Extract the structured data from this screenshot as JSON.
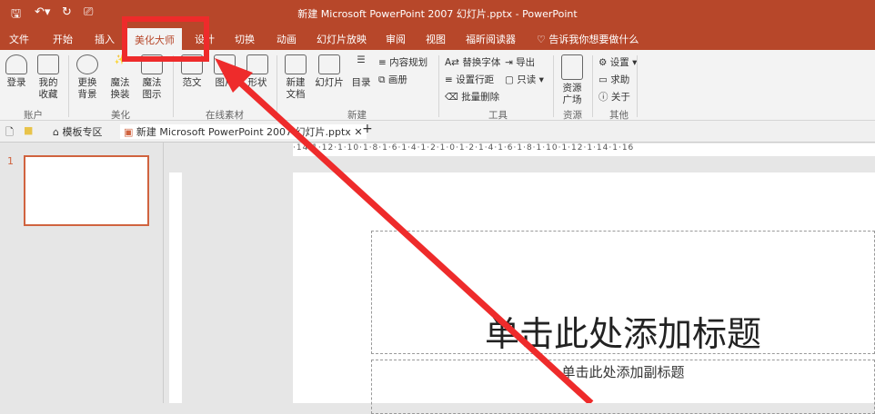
{
  "window": {
    "title": "新建 Microsoft PowerPoint 2007 幻灯片.pptx  -  PowerPoint"
  },
  "quick_access": [
    "save-icon",
    "undo-icon",
    "redo-icon",
    "present-icon"
  ],
  "tabs": [
    "文件",
    "开始",
    "插入",
    "美化大师",
    "设计",
    "切换",
    "动画",
    "幻灯片放映",
    "审阅",
    "视图",
    "福昕阅读器"
  ],
  "tell_me": "告诉我你想要做什么",
  "ribbon": {
    "account": {
      "label": "账户",
      "login": "登录",
      "fav": "我的收藏"
    },
    "beautify": {
      "label": "美化",
      "bg": "更换背景",
      "magic": "魔法换装",
      "diagram": "魔法图示"
    },
    "online": {
      "label": "在线素材",
      "essay": "范文",
      "image": "图片",
      "shape": "形状"
    },
    "new": {
      "label": "新建",
      "doc": "新建文档",
      "slide": "幻灯片",
      "toc": "目录",
      "plan": "内容规划",
      "album": "画册"
    },
    "tools": {
      "label": "工具",
      "font": "替换字体",
      "export": "导出",
      "spacing": "设置行距",
      "readonly": "只读",
      "batch": "批量删除"
    },
    "resources": {
      "label": "资源",
      "square": "资源广场"
    },
    "other": {
      "label": "其他",
      "settings": "设置",
      "help": "求助",
      "about": "关于"
    }
  },
  "docbar": {
    "templates": "模板专区",
    "file": "新建 Microsoft PowerPoint 2007 幻灯片.pptx"
  },
  "ruler": "·14·1·12·1·10·1·8·1·6·1·4·1·2·1·0·1·2·1·4·1·6·1·8·1·10·1·12·1·14·1·16",
  "slide_panel": {
    "number": "1"
  },
  "slide": {
    "title": "单击此处添加标题",
    "subtitle": "单击此处添加副标题"
  },
  "colors": {
    "accent": "#b7472a",
    "highlight": "#ee2b2b"
  }
}
